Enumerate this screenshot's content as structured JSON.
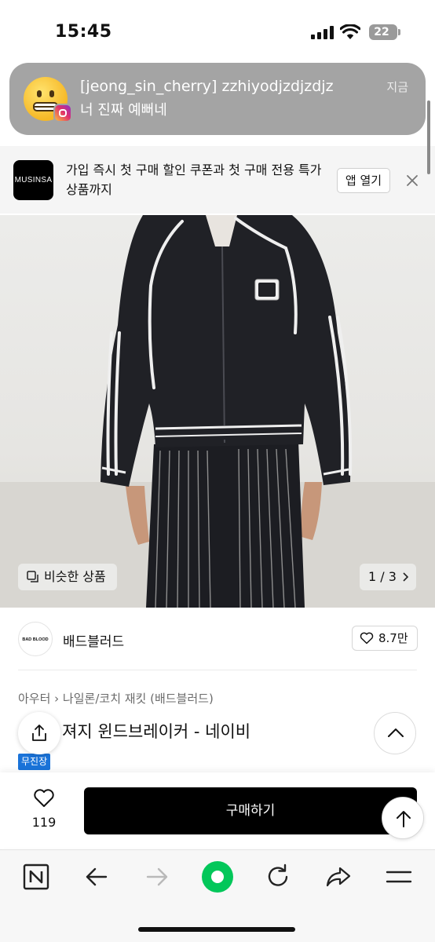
{
  "status_bar": {
    "time": "15:45",
    "battery": "22"
  },
  "notification": {
    "title": "[jeong_sin_cherry] zzhiyodjzdjzdjz",
    "body": "너 진짜 예뻐네",
    "time": "지금",
    "icon": "grimacing-face-emoji",
    "app_badge": "instagram-icon"
  },
  "app_banner": {
    "logo_text": "MUSINSA",
    "text": "가입 즉시 첫 구매 할인 쿠폰과 첫 구매 전용 특가 상품까지",
    "open_label": "앱 열기",
    "close_icon": "close-icon"
  },
  "gallery": {
    "similar_label": "비슷한 상품",
    "pager": "1 / 3"
  },
  "brand": {
    "logo_text": "BAD BLOOD",
    "name": "배드블러드",
    "likes": "8.7만"
  },
  "product": {
    "breadcrumb": "아우터 › 나일론/코치 재킷 (배드블러드)",
    "title": "져지 윈드브레이커 - 네이비",
    "tag": "무진장"
  },
  "buy_bar": {
    "wish_count": "119",
    "buy_label": "구매하기"
  },
  "browser_toolbar": {
    "items": [
      "naver-n-icon",
      "back-arrow-icon",
      "forward-arrow-icon",
      "green-home-icon",
      "reload-icon",
      "share-arrow-icon",
      "menu-icon"
    ]
  },
  "colors": {
    "tag_blue": "#1a73d9",
    "buy_button": "#000000",
    "naver_green": "#03c75a",
    "notification_bg": "#a4a4a4"
  }
}
